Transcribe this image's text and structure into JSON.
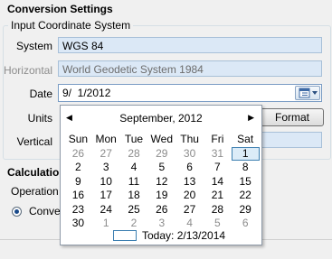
{
  "section_title": "Conversion Settings",
  "input_group": {
    "title": "Input Coordinate System"
  },
  "system": {
    "label": "System",
    "value": "WGS 84"
  },
  "horizontal": {
    "label": "Horizontal",
    "value": "World Geodetic System 1984"
  },
  "date": {
    "label": "Date",
    "value": "9/  1/2012"
  },
  "units": {
    "label": "Units",
    "format_button": "Format"
  },
  "vertical": {
    "label": "Vertical"
  },
  "calculation": {
    "title": "Calculation",
    "operation_label": "Operation",
    "radio_label": "Conver"
  },
  "calendar": {
    "month_label": "September, 2012",
    "prev_glyph": "◀",
    "next_glyph": "▶",
    "days_of_week": [
      "Sun",
      "Mon",
      "Tue",
      "Wed",
      "Thu",
      "Fri",
      "Sat"
    ],
    "weeks": [
      [
        "26",
        "27",
        "28",
        "29",
        "30",
        "31",
        "1"
      ],
      [
        "2",
        "3",
        "4",
        "5",
        "6",
        "7",
        "8"
      ],
      [
        "9",
        "10",
        "11",
        "12",
        "13",
        "14",
        "15"
      ],
      [
        "16",
        "17",
        "18",
        "19",
        "20",
        "21",
        "22"
      ],
      [
        "23",
        "24",
        "25",
        "26",
        "27",
        "28",
        "29"
      ],
      [
        "30",
        "1",
        "2",
        "3",
        "4",
        "5",
        "6"
      ]
    ],
    "other_month_cells": [
      [
        0,
        0
      ],
      [
        0,
        1
      ],
      [
        0,
        2
      ],
      [
        0,
        3
      ],
      [
        0,
        4
      ],
      [
        0,
        5
      ],
      [
        5,
        1
      ],
      [
        5,
        2
      ],
      [
        5,
        3
      ],
      [
        5,
        4
      ],
      [
        5,
        5
      ],
      [
        5,
        6
      ]
    ],
    "selected_cell": [
      0,
      6
    ],
    "today_label": "Today: 2/13/2014"
  }
}
